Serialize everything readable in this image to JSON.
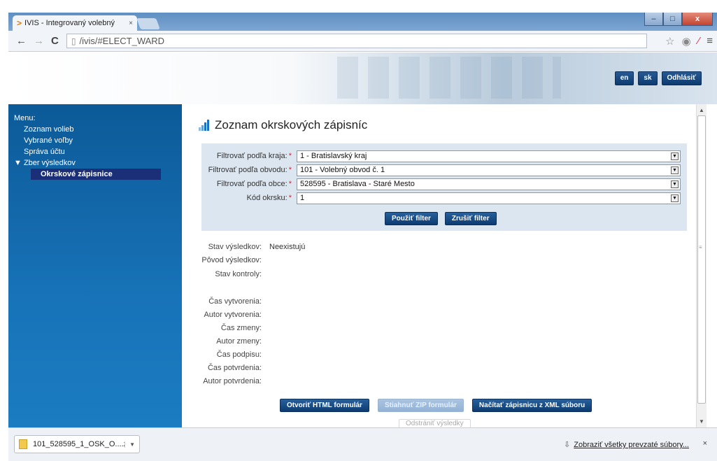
{
  "browser": {
    "tab_title": "IVIS - Integrovaný volebný",
    "tab_close": "×",
    "url": "/ivis/#ELECT_WARD",
    "back": "←",
    "forward": "→",
    "reload": "C",
    "min": "–",
    "max": "□",
    "close": "x"
  },
  "header": {
    "lang_en": "en",
    "lang_sk": "sk",
    "logout": "Odhlásiť"
  },
  "sidebar": {
    "menu_label": "Menu:",
    "items": [
      {
        "label": "Zoznam volieb"
      },
      {
        "label": "Vybrané voľby"
      },
      {
        "label": "Správa účtu"
      },
      {
        "label": "▼ Zber výsledkov"
      },
      {
        "label": "Okrskové zápisnice"
      }
    ]
  },
  "main": {
    "title": "Zoznam okrskových zápisníc",
    "filters": [
      {
        "label": "Filtrovať podľa kraja:",
        "value": "1 - Bratislavský kraj"
      },
      {
        "label": "Filtrovať podľa obvodu:",
        "value": "101 - Volebný obvod č. 1"
      },
      {
        "label": "Filtrovať podľa obce:",
        "value": "528595 - Bratislava - Staré Mesto"
      },
      {
        "label": "Kód okrsku:",
        "value": "1"
      }
    ],
    "required_mark": "*",
    "apply_filter": "Použiť filter",
    "cancel_filter": "Zrušiť filter",
    "info": [
      {
        "label": "Stav výsledkov:",
        "value": "Neexistujú"
      },
      {
        "label": "Pôvod výsledkov:",
        "value": ""
      },
      {
        "label": "Stav kontroly:",
        "value": ""
      },
      {
        "label": "Čas vytvorenia:",
        "value": ""
      },
      {
        "label": "Autor vytvorenia:",
        "value": ""
      },
      {
        "label": "Čas zmeny:",
        "value": ""
      },
      {
        "label": "Autor zmeny:",
        "value": ""
      },
      {
        "label": "Čas podpisu:",
        "value": ""
      },
      {
        "label": "Čas potvrdenia:",
        "value": ""
      },
      {
        "label": "Autor potvrdenia:",
        "value": ""
      }
    ],
    "open_html": "Otvoriť HTML formulár",
    "download_zip": "Stiahnuť ZIP formulár",
    "load_xml": "Načítať zápisnicu z XML súboru",
    "remove_results": "Odstrániť výsledky"
  },
  "downloads": {
    "file": "101_528595_1_OSK_O....zip",
    "show_all": "Zobraziť všetky prevzaté súbory...",
    "close": "×"
  }
}
